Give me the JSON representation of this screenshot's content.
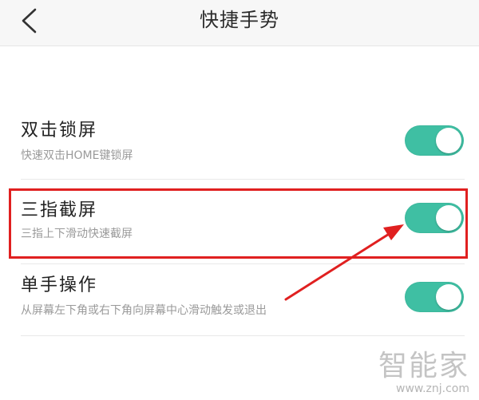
{
  "header": {
    "title": "快捷手势",
    "back_icon": "chevron-left-icon"
  },
  "settings": [
    {
      "title": "双击锁屏",
      "subtitle": "快速双击HOME键锁屏",
      "enabled": true
    },
    {
      "title": "三指截屏",
      "subtitle": "三指上下滑动快速截屏",
      "enabled": true
    },
    {
      "title": "单手操作",
      "subtitle": "从屏幕左下角或右下角向屏幕中心滑动触发或退出",
      "enabled": true
    }
  ],
  "annotation": {
    "highlight_color": "#e02020",
    "target_setting": "三指截屏"
  },
  "watermark": {
    "logo": "智能家",
    "url": "www.znj.com"
  },
  "colors": {
    "toggle_on": "#3fbfa3",
    "header_bg": "#f7f7f7"
  }
}
